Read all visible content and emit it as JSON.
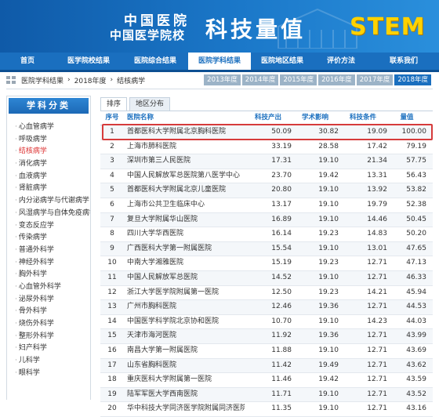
{
  "banner": {
    "line1": "中国医院",
    "line2": "中国医学院校",
    "title": "科技量值",
    "badge": "STEM"
  },
  "nav": [
    "首页",
    "医学院校结果",
    "医院综合结果",
    "医院学科结果",
    "医院地区结果",
    "评价方法",
    "联系我们"
  ],
  "breadcrumb": [
    "医院学科结果",
    "2018年度",
    "结核病学"
  ],
  "years": [
    "2013年度",
    "2014年度",
    "2015年度",
    "2016年度",
    "2017年度",
    "2018年度"
  ],
  "sidebar": {
    "title": "学科分类",
    "items": [
      "心血管病学",
      "呼吸病学",
      "结核病学",
      "消化病学",
      "血液病学",
      "肾脏病学",
      "内分泌病学与代谢病学",
      "风湿病学与自体免疫病学",
      "变态反应学",
      "传染病学",
      "普通外科学",
      "神经外科学",
      "胸外科学",
      "心血管外科学",
      "泌尿外科学",
      "骨外科学",
      "烧伤外科学",
      "整形外科学",
      "妇产科学",
      "儿科学",
      "眼科学"
    ]
  },
  "tabs": [
    "排序",
    "地区分布"
  ],
  "table": {
    "headers": [
      "序号",
      "医院名称",
      "科技产出",
      "学术影响",
      "科技条件",
      "量值"
    ],
    "rows": [
      [
        "1",
        "首都医科大学附属北京胸科医院",
        "50.09",
        "30.82",
        "19.09",
        "100.00"
      ],
      [
        "2",
        "上海市肺科医院",
        "33.19",
        "28.58",
        "17.42",
        "79.19"
      ],
      [
        "3",
        "深圳市第三人民医院",
        "17.31",
        "19.10",
        "21.34",
        "57.75"
      ],
      [
        "4",
        "中国人民解放军总医院第八医学中心",
        "23.70",
        "19.42",
        "13.31",
        "56.43"
      ],
      [
        "5",
        "首都医科大学附属北京儿童医院",
        "20.80",
        "19.10",
        "13.92",
        "53.82"
      ],
      [
        "6",
        "上海市公共卫生临床中心",
        "13.17",
        "19.10",
        "19.79",
        "52.38"
      ],
      [
        "7",
        "复旦大学附属华山医院",
        "16.89",
        "19.10",
        "14.46",
        "50.45"
      ],
      [
        "8",
        "四川大学华西医院",
        "16.14",
        "19.23",
        "14.83",
        "50.20"
      ],
      [
        "9",
        "广西医科大学第一附属医院",
        "15.54",
        "19.10",
        "13.01",
        "47.65"
      ],
      [
        "10",
        "中南大学湘雅医院",
        "15.19",
        "19.23",
        "12.71",
        "47.13"
      ],
      [
        "11",
        "中国人民解放军总医院",
        "14.52",
        "19.10",
        "12.71",
        "46.33"
      ],
      [
        "12",
        "浙江大学医学院附属第一医院",
        "12.50",
        "19.23",
        "14.21",
        "45.94"
      ],
      [
        "13",
        "广州市胸科医院",
        "12.46",
        "19.36",
        "12.71",
        "44.53"
      ],
      [
        "14",
        "中国医学科学院北京协和医院",
        "10.70",
        "19.10",
        "14.23",
        "44.03"
      ],
      [
        "15",
        "天津市海河医院",
        "11.92",
        "19.36",
        "12.71",
        "43.99"
      ],
      [
        "16",
        "南昌大学第一附属医院",
        "11.88",
        "19.10",
        "12.71",
        "43.69"
      ],
      [
        "17",
        "山东省胸科医院",
        "11.42",
        "19.49",
        "12.71",
        "43.62"
      ],
      [
        "18",
        "重庆医科大学附属第一医院",
        "11.46",
        "19.42",
        "12.71",
        "43.59"
      ],
      [
        "19",
        "陆军军医大学西南医院",
        "11.71",
        "19.10",
        "12.71",
        "43.52"
      ],
      [
        "20",
        "华中科技大学同济医学院附属同济医院",
        "11.35",
        "19.10",
        "12.71",
        "43.16"
      ]
    ]
  },
  "colors": {
    "brand": "#1a6fbf",
    "highlight": "#d63b3b",
    "badge": "#ffd200"
  }
}
